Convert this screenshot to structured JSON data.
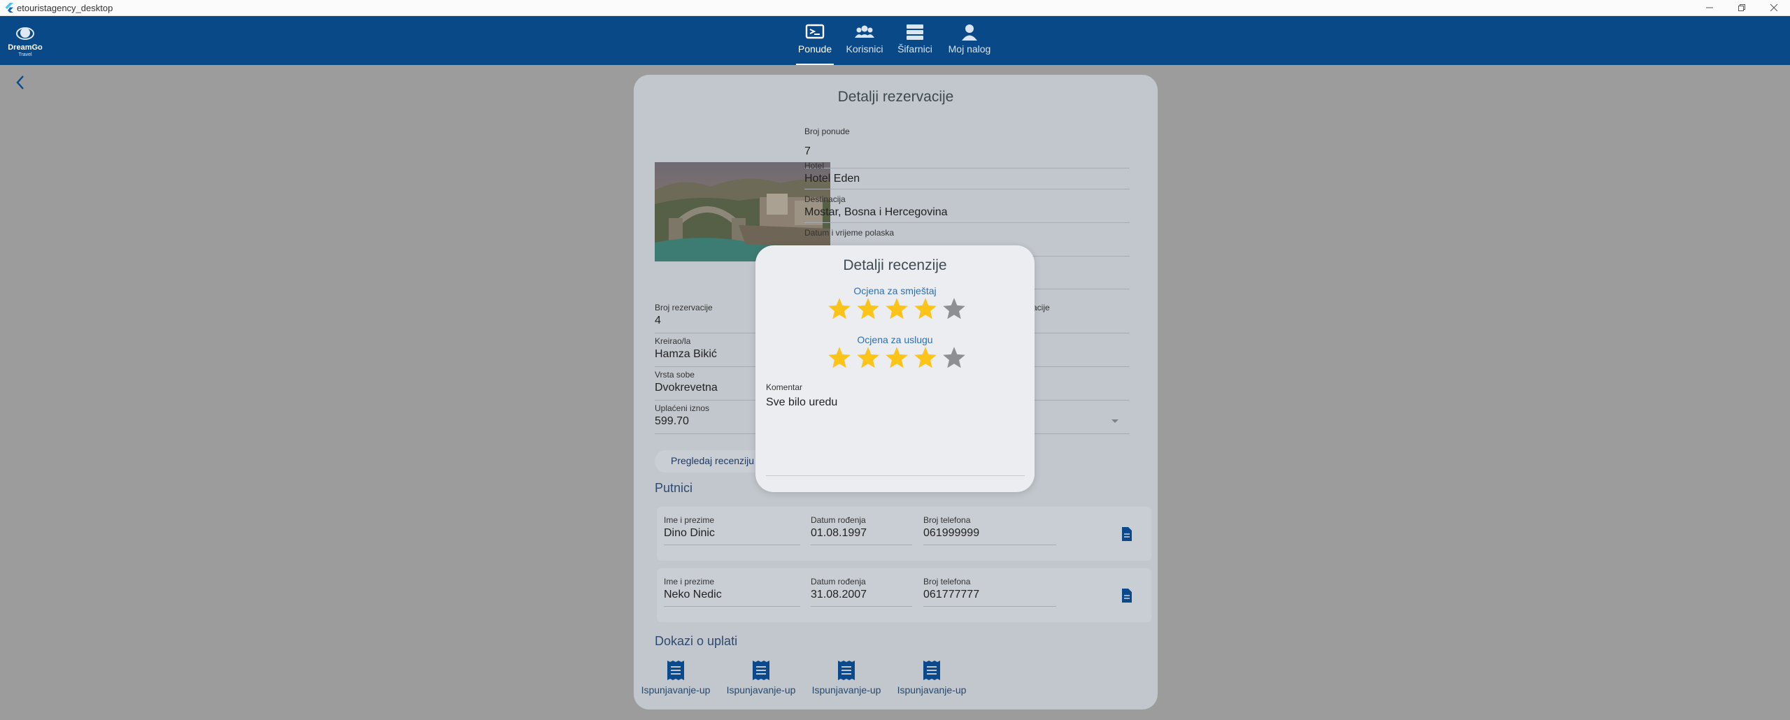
{
  "window": {
    "title": "etouristagency_desktop"
  },
  "navbar": {
    "logo_text": "DreamGo Travel",
    "items": [
      {
        "label": "Ponude",
        "icon": "offers-icon",
        "active": true
      },
      {
        "label": "Korisnici",
        "icon": "users-icon",
        "active": false
      },
      {
        "label": "Šifarnici",
        "icon": "list-icon",
        "active": false
      },
      {
        "label": "Moj nalog",
        "icon": "account-icon",
        "active": false
      }
    ]
  },
  "page": {
    "title": "Detalji rezervacije",
    "fields_right": [
      {
        "label": "Broj ponude",
        "value": "7"
      },
      {
        "label": "Hotel",
        "value": "Hotel Eden"
      },
      {
        "label": "Destinacija",
        "value": "Mostar, Bosna i Hercegovina"
      },
      {
        "label": "Datum i vrijeme polaska",
        "value": ""
      }
    ],
    "fields_left": [
      {
        "label": "Broj rezervacije",
        "value": "4"
      },
      {
        "label": "Kreirao/la",
        "value": "Hamza Bikić"
      },
      {
        "label": "Vrsta sobe",
        "value": "Dvokrevetna"
      },
      {
        "label": "Uplaćeni iznos",
        "value": "599.70"
      }
    ],
    "partial_label": "acije",
    "review_button": "Pregledaj recenziju",
    "travelers_heading": "Putnici",
    "traveler_labels": {
      "name": "Ime i prezime",
      "dob": "Datum rođenja",
      "phone": "Broj telefona"
    },
    "travelers": [
      {
        "name": "Dino Dinic",
        "dob": "01.08.1997",
        "phone": "061999999"
      },
      {
        "name": "Neko Nedic",
        "dob": "31.08.2007",
        "phone": "061777777"
      }
    ],
    "payments_heading": "Dokazi o uplati",
    "payments": [
      "Ispunjavanje-up",
      "Ispunjavanje-up",
      "Ispunjavanje-up",
      "Ispunjavanje-up"
    ]
  },
  "modal": {
    "title": "Detalji recenzije",
    "accommodation_label": "Ocjena za smještaj",
    "accommodation_rating": 4,
    "service_label": "Ocjena za uslugu",
    "service_rating": 4,
    "max_rating": 5,
    "comment_label": "Komentar",
    "comment": "Sve bilo uredu"
  },
  "colors": {
    "nav": "#0a4988",
    "star_on": "#fcc419",
    "star_off": "#8d8f93",
    "accent": "#2f6fb0"
  }
}
